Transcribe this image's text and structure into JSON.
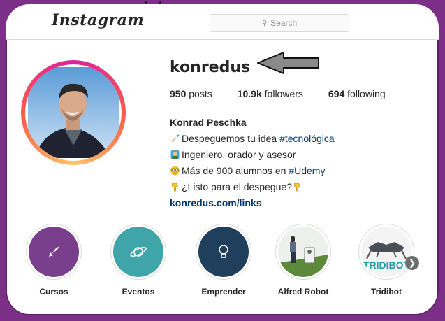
{
  "header": {
    "logo": "Instagram",
    "search_placeholder": "Search",
    "search_icon": "search-icon"
  },
  "profile": {
    "username": "konredus",
    "stats": [
      {
        "value": "950",
        "label": "posts"
      },
      {
        "value": "10.9k",
        "label": "followers"
      },
      {
        "value": "694",
        "label": "following"
      }
    ],
    "full_name": "Konrad Peschka",
    "bio": {
      "line1_text": "Despeguemos tu idea ",
      "line1_tag": "#tecnológica",
      "line2_text": "Ingeniero, orador y asesor",
      "line3_text": "Más de 900 alumnos en ",
      "line3_tag": "#Udemy",
      "line4_text": "¿Listo para el despegue?"
    },
    "link": "konredus.com/links"
  },
  "highlights": [
    {
      "label": "Cursos",
      "icon": "rocket-icon",
      "color": "#7a3f8c"
    },
    {
      "label": "Eventos",
      "icon": "planet-icon",
      "color": "#3fa5a9"
    },
    {
      "label": "Emprender",
      "icon": "lightbulb-icon",
      "color": "#1f3f5c"
    },
    {
      "label": "Alfred Robot",
      "icon": "robot-photo"
    },
    {
      "label": "Tridibot",
      "icon": "tridibot-photo",
      "photo_text": "TRIDIBOT"
    }
  ],
  "colors": {
    "background": "#7b2f86",
    "link": "#00376b",
    "text": "#262626"
  }
}
